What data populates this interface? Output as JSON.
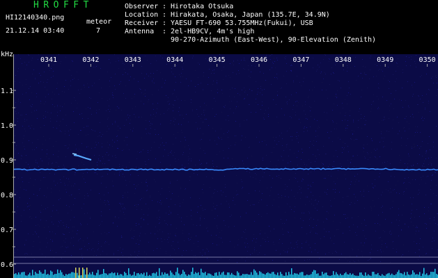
{
  "header": {
    "app_title": "HROFFT",
    "filename": "HI12140340.png",
    "datetime": "21.12.14 03:40",
    "meteor_label": "meteor",
    "meteor_count": "7",
    "info": [
      {
        "key": "Observer",
        "sep": ":",
        "value": "Hirotaka Otsuka"
      },
      {
        "key": "Location",
        "sep": ":",
        "value": "Hirakata, Osaka, Japan (135.7E, 34.9N)"
      },
      {
        "key": "Receiver",
        "sep": ":",
        "value": "YAESU FT-690 53.755MHz(Fukui), USB"
      },
      {
        "key": "Antenna",
        "sep": ":",
        "value": "2el-HB9CV, 4m's high"
      },
      {
        "key": "",
        "sep": "",
        "value": "90-270-Azimuth (East-West), 90-Elevation (Zenith)"
      }
    ]
  },
  "spectrogram": {
    "unit_label": "kHz",
    "time_labels": [
      "0341",
      "0342",
      "0343",
      "0344",
      "0345",
      "0346",
      "0347",
      "0348",
      "0349",
      "0350"
    ],
    "freq_labels": [
      "1.1",
      "1.0",
      "0.9",
      "0.8",
      "0.7",
      "0.6"
    ],
    "colors": {
      "background": "#000000",
      "plot_bg": "#0b0b46",
      "text": "#ffffff",
      "title": "#22dd44",
      "carrier": "#3a8cff",
      "meteor": "#5aaaff",
      "baseline": "#20c8e8",
      "axis": "#aaaaaa"
    }
  }
}
